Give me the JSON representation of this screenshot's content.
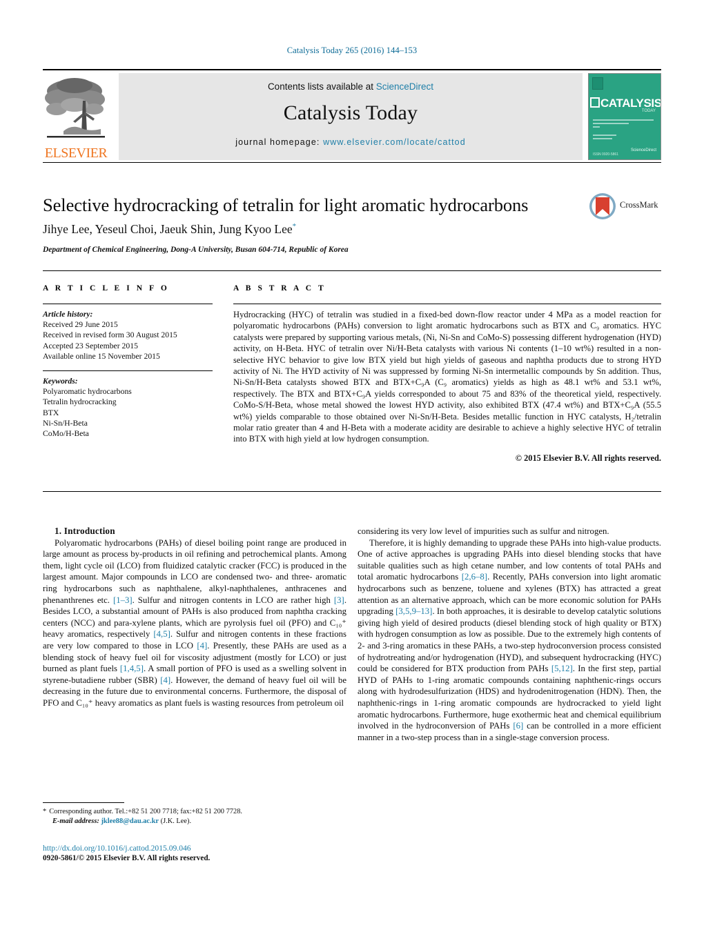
{
  "running_head": "Catalysis Today 265 (2016) 144–153",
  "masthead": {
    "contents_prefix": "Contents lists available at ",
    "sciencedirect": "ScienceDirect",
    "journal_name": "Catalysis Today",
    "homepage_prefix": "journal homepage: ",
    "homepage_url": "www.elsevier.com/locate/cattod",
    "publisher": "ELSEVIER",
    "cover": {
      "title": "CATALYSIS",
      "tag": "TODAY",
      "sciencedirect": "ScienceDirect",
      "issn": "ISSN 0920-5861"
    }
  },
  "article": {
    "title": "Selective hydrocracking of tetralin for light aromatic hydrocarbons",
    "authors": "Jihye Lee, Yeseul Choi, Jaeuk Shin, Jung Kyoo Lee",
    "author_marker": "*",
    "affiliation": "Department of Chemical Engineering, Dong-A University, Busan 604-714, Republic of Korea",
    "crossmark_label": "CrossMark"
  },
  "info": {
    "heading": "A R T I C L E    I N F O",
    "history_label": "Article history:",
    "history": [
      "Received 29 June 2015",
      "Received in revised form 30 August 2015",
      "Accepted 23 September 2015",
      "Available online 15 November 2015"
    ],
    "keywords_label": "Keywords:",
    "keywords": [
      "Polyaromatic hydrocarbons",
      "Tetralin hydrocracking",
      "BTX",
      "Ni-Sn/H-Beta",
      "CoMo/H-Beta"
    ]
  },
  "abstract": {
    "heading": "A B S T R A C T",
    "body": "Hydrocracking (HYC) of tetralin was studied in a fixed-bed down-flow reactor under 4 MPa as a model reaction for polyaromatic hydrocarbons (PAHs) conversion to light aromatic hydrocarbons such as BTX and C₉ aromatics. HYC catalysts were prepared by supporting various metals, (Ni, Ni-Sn and CoMo-S) possessing different hydrogenation (HYD) activity, on H-Beta. HYC of tetralin over Ni/H-Beta catalysts with various Ni contents (1–10 wt%) resulted in a non-selective HYC behavior to give low BTX yield but high yields of gaseous and naphtha products due to strong HYD activity of Ni. The HYD activity of Ni was suppressed by forming Ni-Sn intermetallic compounds by Sn addition. Thus, Ni-Sn/H-Beta catalysts showed BTX and BTX+C₉A (C₉ aromatics) yields as high as 48.1 wt% and 53.1 wt%, respectively. The BTX and BTX+C₉A yields corresponded to about 75 and 83% of the theoretical yield, respectively. CoMo-S/H-Beta, whose metal showed the lowest HYD activity, also exhibited BTX (47.4 wt%) and BTX+C₉A (55.5 wt%) yields comparable to those obtained over Ni-Sn/H-Beta. Besides metallic function in HYC catalysts, H₂/tetralin molar ratio greater than 4 and H-Beta with a moderate acidity are desirable to achieve a highly selective HYC of tetralin into BTX with high yield at low hydrogen consumption.",
    "copyright": "© 2015 Elsevier B.V. All rights reserved."
  },
  "introduction": {
    "heading": "1.  Introduction",
    "left_paragraph_1_a": "Polyaromatic hydrocarbons (PAHs) of diesel boiling point range are produced in large amount as process by-products in oil refining and petrochemical plants. Among them, light cycle oil (LCO) from fluidized catalytic cracker (FCC) is produced in the largest amount. Major compounds in LCO are condensed two- and three- aromatic ring hydrocarbons such as naphthalene, alkyl-naphthalenes, anthracenes and phenanthrenes etc. ",
    "ref_1_3": "[1–3]",
    "left_paragraph_1_b": ". Sulfur and nitrogen contents in LCO are rather high ",
    "ref_3": "[3]",
    "left_paragraph_1_c": ". Besides LCO, a substantial amount of PAHs is also produced from naphtha cracking centers (NCC) and para-xylene plants, which are pyrolysis fuel oil (PFO) and C₁₀⁺ heavy aromatics, respectively ",
    "ref_4_5": "[4,5]",
    "left_paragraph_1_d": ". Sulfur and nitrogen contents in these fractions are very low compared to those in LCO ",
    "ref_4": "[4]",
    "left_paragraph_1_e": ". Presently, these PAHs are used as a blending stock of heavy fuel oil for viscosity adjustment (mostly for LCO) or just burned as plant fuels ",
    "ref_1_4_5": "[1,4,5]",
    "left_paragraph_1_f": ". A small portion of PFO is used as a swelling solvent in styrene-butadiene rubber (SBR) ",
    "ref_4_b": "[4]",
    "left_paragraph_1_g": ". However, the demand of heavy fuel oil will be decreasing in the future due to environmental concerns. Furthermore, the disposal of PFO and C₁₀⁺ heavy aromatics as plant fuels is wasting resources from petroleum oil",
    "right_continuation": "considering its very low level of impurities such as sulfur and nitrogen.",
    "right_paragraph_a": "Therefore, it is highly demanding to upgrade these PAHs into high-value products. One of active approaches is upgrading PAHs into diesel blending stocks that have suitable qualities such as high cetane number, and low contents of total PAHs and total aromatic hydrocarbons ",
    "ref_2_6_8": "[2,6–8]",
    "right_paragraph_b": ". Recently, PAHs conversion into light aromatic hydrocarbons such as benzene, toluene and xylenes (BTX) has attracted a great attention as an alternative approach, which can be more economic solution for PAHs upgrading ",
    "ref_3_5_9_13": "[3,5,9–13]",
    "right_paragraph_c": ". In both approaches, it is desirable to develop catalytic solutions giving high yield of desired products (diesel blending stock of high quality or BTX) with hydrogen consumption as low as possible. Due to the extremely high contents of 2- and 3-ring aromatics in these PAHs, a two-step hydroconversion process consisted of hydrotreating and/or hydrogenation (HYD), and subsequent hydrocracking (HYC) could be considered for BTX production from PAHs ",
    "ref_5_12": "[5,12]",
    "right_paragraph_d": ". In the first step, partial HYD of PAHs to 1-ring aromatic compounds containing naphthenic-rings occurs along with hydrodesulfurization (HDS) and hydrodenitrogenation (HDN). Then, the naphthenic-rings in 1-ring aromatic compounds are hydrocracked to yield light aromatic hydrocarbons. Furthermore, huge exothermic heat and chemical equilibrium involved in the hydroconversion of PAHs ",
    "ref_6": "[6]",
    "right_paragraph_e": " can be controlled in a more efficient manner in a two-step process than in a single-stage conversion process."
  },
  "footnote": {
    "star": "*",
    "corresponding": "Corresponding author. Tel.:+82 51 200 7718; fax:+82 51 200 7728.",
    "email_label": "E-mail address:",
    "email": "jklee88@dau.ac.kr",
    "email_suffix": "(J.K. Lee)."
  },
  "doi": {
    "url": "http://dx.doi.org/10.1016/j.cattod.2015.09.046",
    "issn_line": "0920-5861/© 2015 Elsevier B.V. All rights reserved."
  },
  "colors": {
    "link": "#1f7fa8",
    "elsevier_orange": "#ef7622",
    "cover_green": "#2aa383",
    "crossmark_red": "#d8402f"
  }
}
